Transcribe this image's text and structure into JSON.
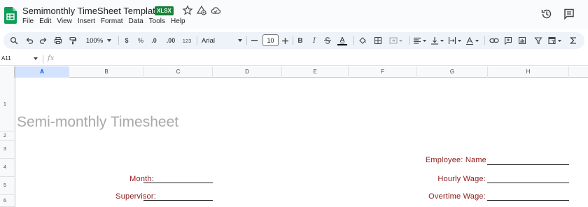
{
  "app": {
    "doc_title": "Semimonthly TimeSheet Template",
    "file_badge": "XLSX",
    "menu": [
      "File",
      "Edit",
      "View",
      "Insert",
      "Format",
      "Data",
      "Tools",
      "Help"
    ]
  },
  "toolbar": {
    "zoom": "100%",
    "currency": "$",
    "percent": "%",
    "decrease_decimal": ".0",
    "increase_decimal": ".00",
    "number_format": "123",
    "font": "Arial",
    "font_size": "10",
    "bold": "B",
    "italic": "I",
    "text_color": "A"
  },
  "formula_bar": {
    "cell_ref": "A11",
    "fx": "fx"
  },
  "grid": {
    "columns": [
      "A",
      "B",
      "C",
      "D",
      "E",
      "F",
      "G",
      "H"
    ],
    "selected_column": "A",
    "rows": [
      "1",
      "2",
      "3",
      "4",
      "5",
      "6"
    ]
  },
  "sheet": {
    "title": "Semi-monthly Timesheet",
    "month_label": "Month:",
    "supervisor_label": "Supervisor:",
    "employee_label": "Employee: Name",
    "hourly_wage_label": "Hourly Wage:",
    "overtime_wage_label": "Overtime Wage:"
  },
  "colors": {
    "label_red": "#8b1a1a",
    "title_gray": "#a9a9a9",
    "accent_blue": "#0b57d0",
    "sheets_green": "#188038"
  }
}
